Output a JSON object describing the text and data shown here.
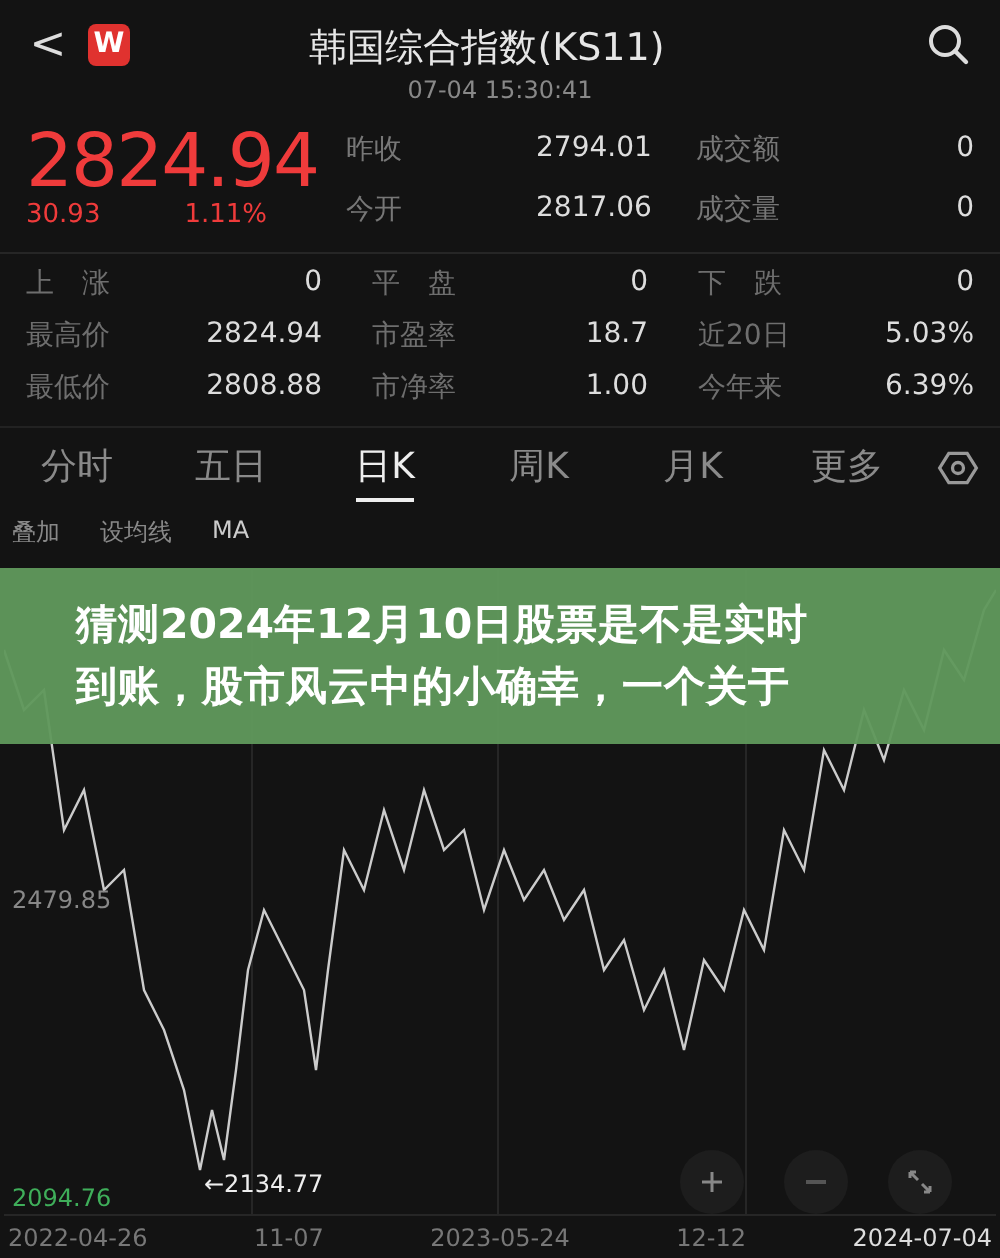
{
  "header": {
    "back": "<",
    "logo": "W",
    "title": "韩国综合指数(KS11)",
    "time": "07-04 15:30:41"
  },
  "quote": {
    "price": "2824.94",
    "change": "30.93",
    "percent": "1.11%",
    "fields": [
      {
        "label": "昨收",
        "value": "2794.01"
      },
      {
        "label": "成交额",
        "value": "0"
      },
      {
        "label": "今开",
        "value": "2817.06"
      },
      {
        "label": "成交量",
        "value": "0"
      }
    ]
  },
  "stats": [
    {
      "label": "上　涨",
      "value": "0"
    },
    {
      "label": "平　盘",
      "value": "0"
    },
    {
      "label": "下　跌",
      "value": "0"
    },
    {
      "label": "最高价",
      "value": "2824.94"
    },
    {
      "label": "市盈率",
      "value": "18.7"
    },
    {
      "label": "近20日",
      "value": "5.03%"
    },
    {
      "label": "最低价",
      "value": "2808.88"
    },
    {
      "label": "市净率",
      "value": "1.00"
    },
    {
      "label": "今年来",
      "value": "6.39%"
    }
  ],
  "tabs": [
    {
      "label": "分时",
      "selected": false
    },
    {
      "label": "五日",
      "selected": false
    },
    {
      "label": "日K",
      "selected": true
    },
    {
      "label": "周K",
      "selected": false
    },
    {
      "label": "月K",
      "selected": false
    },
    {
      "label": "更多",
      "selected": false
    }
  ],
  "chart_tools": [
    "叠加",
    "设均线",
    "MA"
  ],
  "chart": {
    "y_labels": [
      "2479.85",
      "2094.76"
    ],
    "low_marker": "←2134.77",
    "x_labels": [
      "2022-04-26",
      "11-07",
      "2023-05-24",
      "12-12",
      "2024-07-04"
    ]
  },
  "banner": {
    "lines": [
      "猜测2024年12月10日股票是不是实时",
      "到账，股市风云中的小确幸，一个关于"
    ]
  }
}
